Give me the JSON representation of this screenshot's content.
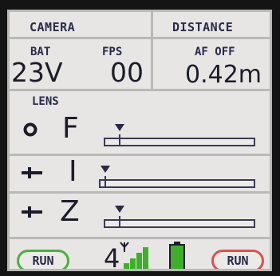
{
  "camera": {
    "header": "CAMERA",
    "battery_label": "BAT",
    "battery_value": "23V",
    "fps_label": "FPS",
    "fps_value": "00"
  },
  "distance": {
    "header": "DISTANCE",
    "af_label": "AF OFF",
    "value": "0.42m"
  },
  "lens": {
    "header": "LENS",
    "focus": {
      "letter": "F",
      "icon": "circle-icon",
      "level": 0.07
    },
    "iris": {
      "letter": "I",
      "icon": "iris-icon",
      "level": 0.0
    },
    "zoom": {
      "letter": "Z",
      "icon": "zoom-icon",
      "level": 0.07
    }
  },
  "footer": {
    "left_run_label": "RUN",
    "right_run_label": "RUN",
    "channel": "4",
    "signal_bars": 4,
    "battery_fill": 1.0
  },
  "colors": {
    "background": "#e7e6e4",
    "divider": "#b9b9b7",
    "text": "#1c1c2a",
    "run_left_border": "#4caf3f",
    "run_right_border": "#d9534f",
    "signal_green": "#3fae2a",
    "battery_green": "#3fae2a"
  }
}
